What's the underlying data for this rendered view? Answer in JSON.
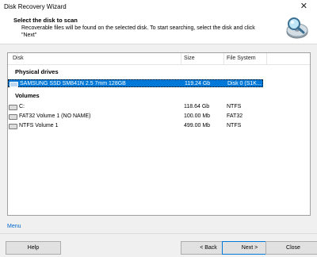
{
  "window": {
    "title": "Disk Recovery Wizard",
    "close_glyph": "✕"
  },
  "header": {
    "title": "Select the disk to scan",
    "description": "Recoverable files will be found on the selected disk. To start searching, select the disk and click \"Next\""
  },
  "columns": {
    "disk": "Disk",
    "size": "Size",
    "fs": "File System"
  },
  "groups": {
    "physical": "Physical drives",
    "volumes": "Volumes"
  },
  "physical_drives": [
    {
      "name": "SAMSUNG SSD SM841N 2.5 7mm 128GB",
      "size": "119.24 Gb",
      "fs": "Disk 0 (S1K..."
    }
  ],
  "volumes": [
    {
      "name": "C:",
      "size": "118.64 Gb",
      "fs": "NTFS"
    },
    {
      "name": "FAT32 Volume 1 (NO NAME)",
      "size": "100.00 Mb",
      "fs": "FAT32"
    },
    {
      "name": "NTFS Volume 1",
      "size": "499.00 Mb",
      "fs": "NTFS"
    }
  ],
  "menu_link": "Menu",
  "buttons": {
    "help": "Help",
    "back": "< Back",
    "next": "Next >",
    "close": "Close"
  },
  "colors": {
    "accent": "#0078d7",
    "link": "#0066cc"
  },
  "icons": {
    "logo": "magnifier-disk-icon",
    "drive": "hard-drive-icon"
  }
}
